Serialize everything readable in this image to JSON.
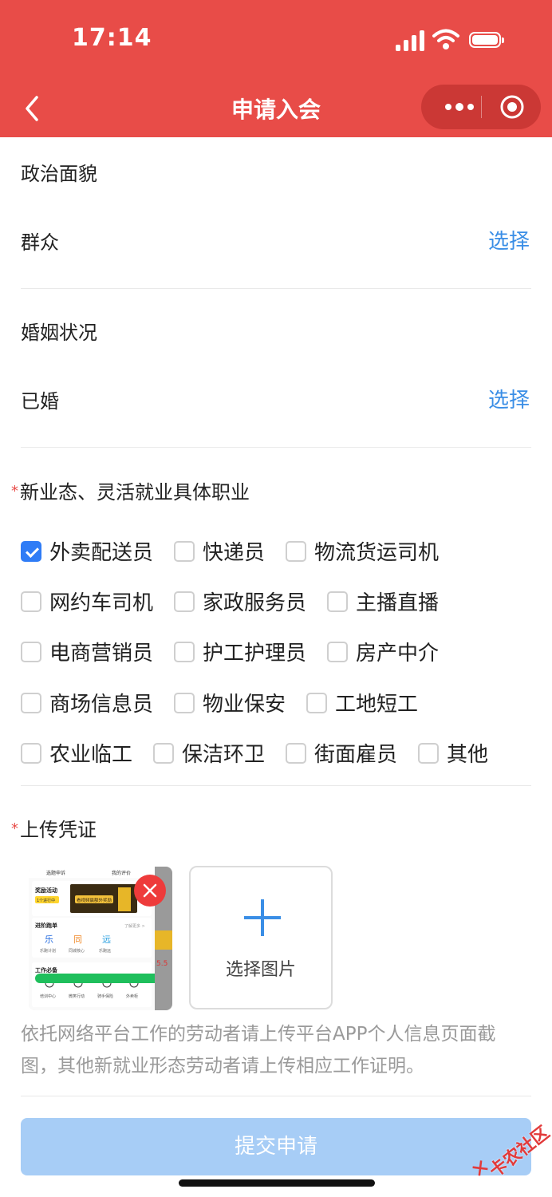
{
  "status": {
    "time": "17:14"
  },
  "nav": {
    "title": "申请入会"
  },
  "political": {
    "label": "政治面貌",
    "value": "群众",
    "action": "选择"
  },
  "marital": {
    "label": "婚姻状况",
    "value": "已婚",
    "action": "选择"
  },
  "occupation": {
    "required_mark": "*",
    "label": "新业态、灵活就业具体职业",
    "options": [
      {
        "label": "外卖配送员",
        "checked": true
      },
      {
        "label": "快递员",
        "checked": false
      },
      {
        "label": "物流货运司机",
        "checked": false
      },
      {
        "label": "网约车司机",
        "checked": false
      },
      {
        "label": "家政服务员",
        "checked": false
      },
      {
        "label": "主播直播",
        "checked": false
      },
      {
        "label": "电商营销员",
        "checked": false
      },
      {
        "label": "护工护理员",
        "checked": false
      },
      {
        "label": "房产中介",
        "checked": false
      },
      {
        "label": "商场信息员",
        "checked": false
      },
      {
        "label": "物业保安",
        "checked": false
      },
      {
        "label": "工地短工",
        "checked": false
      },
      {
        "label": "农业临工",
        "checked": false
      },
      {
        "label": "保洁环卫",
        "checked": false
      },
      {
        "label": "街面雇员",
        "checked": false
      },
      {
        "label": "其他",
        "checked": false
      }
    ]
  },
  "upload": {
    "required_mark": "*",
    "label": "上传凭证",
    "add_label": "选择图片",
    "hint": "依托网络平台工作的劳动者请上传平台APP个人信息页面截图，其他新就业形态劳动者请上传相应工作证明。",
    "thumbnail": {
      "tab_left": "选题申诉",
      "tab_right": "我的评价",
      "promo_title": "奖励活动",
      "promo_badge": "1个进行中",
      "banner": "看视频赢额外奖励",
      "section1": "进阶跑单",
      "section1_more": "了解更多 >",
      "apps": [
        {
          "icon": "乐",
          "name": "乐跑计划"
        },
        {
          "icon": "同",
          "name": "同城核心"
        },
        {
          "icon": "远",
          "name": "乐跑远"
        }
      ],
      "section2": "工作必备",
      "tools": [
        "培训中心",
        "微笑行动",
        "骑手保险",
        "外卖柜"
      ],
      "side_value": "5.5"
    }
  },
  "submit": {
    "label": "提交申请"
  },
  "watermark": {
    "text": "卡农社区"
  },
  "colors": {
    "brand_red": "#e84c48",
    "link_blue": "#3a8ee6",
    "check_blue": "#2f7cf6",
    "submit_disabled": "#a7cdf6"
  }
}
